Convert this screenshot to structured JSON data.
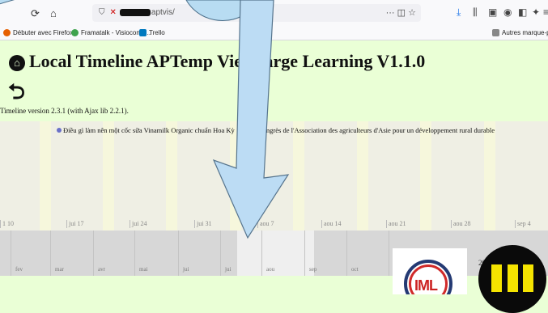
{
  "browser": {
    "url": "aptvis/",
    "bookmarks": [
      {
        "label": "Débuter avec Firefox",
        "color": "#e66000"
      },
      {
        "label": "Framatalk - Visioconfé...",
        "color": "#3fa34d"
      },
      {
        "label": "Trello",
        "color": "#0079bf"
      },
      {
        "label": "Autres marque-pages",
        "color": "#888888"
      }
    ]
  },
  "page": {
    "title": "Local Timeline APTemp Viet Large Learning V1.1.0",
    "version": "Timeline version 2.3.1 (with Ajax lib 2.2.1)."
  },
  "timeline": {
    "events": [
      "Điều gì làm nên một cốc sữa Vinamilk Organic chuẩn Hoa Kỳ",
      "Congrès de l'Association des agriculteurs d'Asie pour un développement rural durable"
    ],
    "day_ticks": [
      "1 10",
      "jui 17",
      "jui 24",
      "jui 31",
      "aou 7",
      "aou 14",
      "aou 21",
      "aou 28",
      "sep 4"
    ],
    "months": [
      "fev",
      "mar",
      "avr",
      "mai",
      "jui",
      "jui",
      "aou",
      "sep",
      "oct"
    ],
    "year": "20"
  },
  "logos": {
    "iml_text": "IML"
  }
}
